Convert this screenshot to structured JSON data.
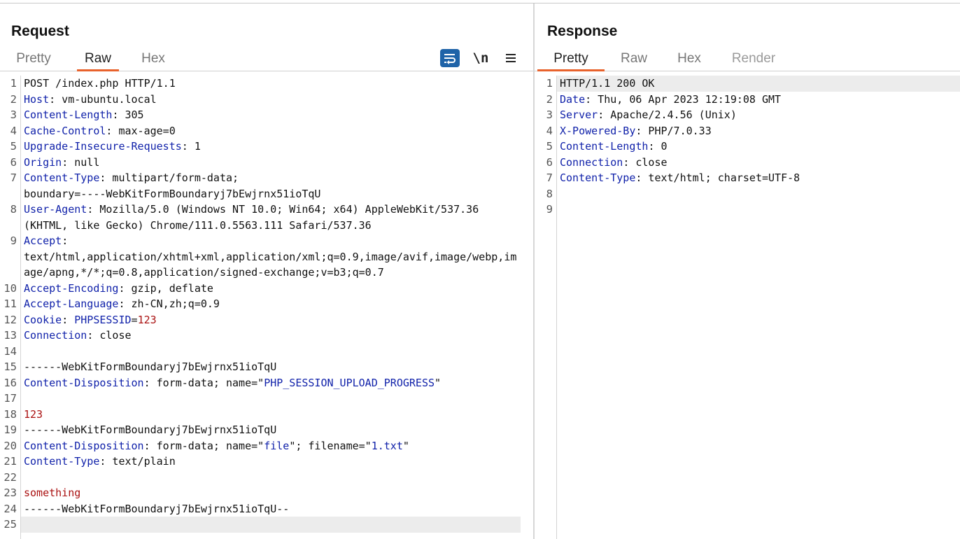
{
  "request": {
    "title": "Request",
    "tabs": [
      "Pretty",
      "Raw",
      "Hex"
    ],
    "active_tab": "Raw",
    "newline_label": "\\n",
    "icons": [
      "wrap-lines-icon",
      "newline-toggle-icon",
      "hamburger-menu-icon"
    ],
    "lines": [
      {
        "n": "1",
        "segs": [
          {
            "t": "POST /index.php HTTP/1.1",
            "c": "v"
          }
        ]
      },
      {
        "n": "2",
        "segs": [
          {
            "t": "Host",
            "c": "k"
          },
          {
            "t": ": vm-ubuntu.local",
            "c": "v"
          }
        ]
      },
      {
        "n": "3",
        "segs": [
          {
            "t": "Content-Length",
            "c": "k"
          },
          {
            "t": ": 305",
            "c": "v"
          }
        ]
      },
      {
        "n": "4",
        "segs": [
          {
            "t": "Cache-Control",
            "c": "k"
          },
          {
            "t": ": max-age=0",
            "c": "v"
          }
        ]
      },
      {
        "n": "5",
        "segs": [
          {
            "t": "Upgrade-Insecure-Requests",
            "c": "k"
          },
          {
            "t": ": 1",
            "c": "v"
          }
        ]
      },
      {
        "n": "6",
        "segs": [
          {
            "t": "Origin",
            "c": "k"
          },
          {
            "t": ": null",
            "c": "v"
          }
        ]
      },
      {
        "n": "7",
        "segs": [
          {
            "t": "Content-Type",
            "c": "k"
          },
          {
            "t": ": multipart/form-data;",
            "c": "v"
          }
        ]
      },
      {
        "n": "",
        "segs": [
          {
            "t": "boundary=----WebKitFormBoundaryj7bEwjrnx51ioTqU",
            "c": "v"
          }
        ]
      },
      {
        "n": "8",
        "segs": [
          {
            "t": "User-Agent",
            "c": "k"
          },
          {
            "t": ": Mozilla/5.0 (Windows NT 10.0; Win64; x64) AppleWebKit/537.36",
            "c": "v"
          }
        ]
      },
      {
        "n": "",
        "segs": [
          {
            "t": "(KHTML, like Gecko) Chrome/111.0.5563.111 Safari/537.36",
            "c": "v"
          }
        ]
      },
      {
        "n": "9",
        "segs": [
          {
            "t": "Accept",
            "c": "k"
          },
          {
            "t": ":",
            "c": "v"
          }
        ]
      },
      {
        "n": "",
        "segs": [
          {
            "t": "text/html,application/xhtml+xml,application/xml;q=0.9,image/avif,image/webp,im",
            "c": "v"
          }
        ]
      },
      {
        "n": "",
        "segs": [
          {
            "t": "age/apng,*/*;q=0.8,application/signed-exchange;v=b3;q=0.7",
            "c": "v"
          }
        ]
      },
      {
        "n": "10",
        "segs": [
          {
            "t": "Accept-Encoding",
            "c": "k"
          },
          {
            "t": ": gzip, deflate",
            "c": "v"
          }
        ]
      },
      {
        "n": "11",
        "segs": [
          {
            "t": "Accept-Language",
            "c": "k"
          },
          {
            "t": ": zh-CN,zh;q=0.9",
            "c": "v"
          }
        ]
      },
      {
        "n": "12",
        "segs": [
          {
            "t": "Cookie",
            "c": "k"
          },
          {
            "t": ": ",
            "c": "v"
          },
          {
            "t": "PHPSESSID",
            "c": "k"
          },
          {
            "t": "=",
            "c": "v"
          },
          {
            "t": "123",
            "c": "r"
          }
        ]
      },
      {
        "n": "13",
        "segs": [
          {
            "t": "Connection",
            "c": "k"
          },
          {
            "t": ": close",
            "c": "v"
          }
        ]
      },
      {
        "n": "14",
        "segs": []
      },
      {
        "n": "15",
        "segs": [
          {
            "t": "------WebKitFormBoundaryj7bEwjrnx51ioTqU",
            "c": "v"
          }
        ]
      },
      {
        "n": "16",
        "segs": [
          {
            "t": "Content-Disposition",
            "c": "k"
          },
          {
            "t": ": form-data; name=\"",
            "c": "v"
          },
          {
            "t": "PHP_SESSION_UPLOAD_PROGRESS",
            "c": "s"
          },
          {
            "t": "\"",
            "c": "v"
          }
        ]
      },
      {
        "n": "17",
        "segs": []
      },
      {
        "n": "18",
        "segs": [
          {
            "t": "123",
            "c": "r"
          }
        ]
      },
      {
        "n": "19",
        "segs": [
          {
            "t": "------WebKitFormBoundaryj7bEwjrnx51ioTqU",
            "c": "v"
          }
        ]
      },
      {
        "n": "20",
        "segs": [
          {
            "t": "Content-Disposition",
            "c": "k"
          },
          {
            "t": ": form-data; name=\"",
            "c": "v"
          },
          {
            "t": "file",
            "c": "s"
          },
          {
            "t": "\"; filename=\"",
            "c": "v"
          },
          {
            "t": "1.txt",
            "c": "s"
          },
          {
            "t": "\"",
            "c": "v"
          }
        ]
      },
      {
        "n": "21",
        "segs": [
          {
            "t": "Content-Type",
            "c": "k"
          },
          {
            "t": ": text/plain",
            "c": "v"
          }
        ]
      },
      {
        "n": "22",
        "segs": []
      },
      {
        "n": "23",
        "segs": [
          {
            "t": "something",
            "c": "r"
          }
        ]
      },
      {
        "n": "24",
        "segs": [
          {
            "t": "------WebKitFormBoundaryj7bEwjrnx51ioTqU--",
            "c": "v"
          }
        ]
      },
      {
        "n": "25",
        "segs": [],
        "highlight": true
      }
    ]
  },
  "response": {
    "title": "Response",
    "tabs": [
      "Pretty",
      "Raw",
      "Hex",
      "Render"
    ],
    "active_tab": "Pretty",
    "disabled_tab": "Render",
    "lines": [
      {
        "n": "1",
        "segs": [
          {
            "t": "HTTP/1.1 200 OK",
            "c": "v"
          }
        ],
        "highlight": true
      },
      {
        "n": "2",
        "segs": [
          {
            "t": "Date",
            "c": "k"
          },
          {
            "t": ": Thu, 06 Apr 2023 12:19:08 GMT",
            "c": "v"
          }
        ]
      },
      {
        "n": "3",
        "segs": [
          {
            "t": "Server",
            "c": "k"
          },
          {
            "t": ": Apache/2.4.56 (Unix)",
            "c": "v"
          }
        ]
      },
      {
        "n": "4",
        "segs": [
          {
            "t": "X-Powered-By",
            "c": "k"
          },
          {
            "t": ": PHP/7.0.33",
            "c": "v"
          }
        ]
      },
      {
        "n": "5",
        "segs": [
          {
            "t": "Content-Length",
            "c": "k"
          },
          {
            "t": ": 0",
            "c": "v"
          }
        ]
      },
      {
        "n": "6",
        "segs": [
          {
            "t": "Connection",
            "c": "k"
          },
          {
            "t": ": close",
            "c": "v"
          }
        ]
      },
      {
        "n": "7",
        "segs": [
          {
            "t": "Content-Type",
            "c": "k"
          },
          {
            "t": ": text/html; charset=UTF-8",
            "c": "v"
          }
        ]
      },
      {
        "n": "8",
        "segs": []
      },
      {
        "n": "9",
        "segs": []
      }
    ]
  },
  "colors": {
    "accent": "#e8622c",
    "key": "#1122aa",
    "value_red": "#aa1111",
    "wrap_button": "#1f63a8"
  }
}
